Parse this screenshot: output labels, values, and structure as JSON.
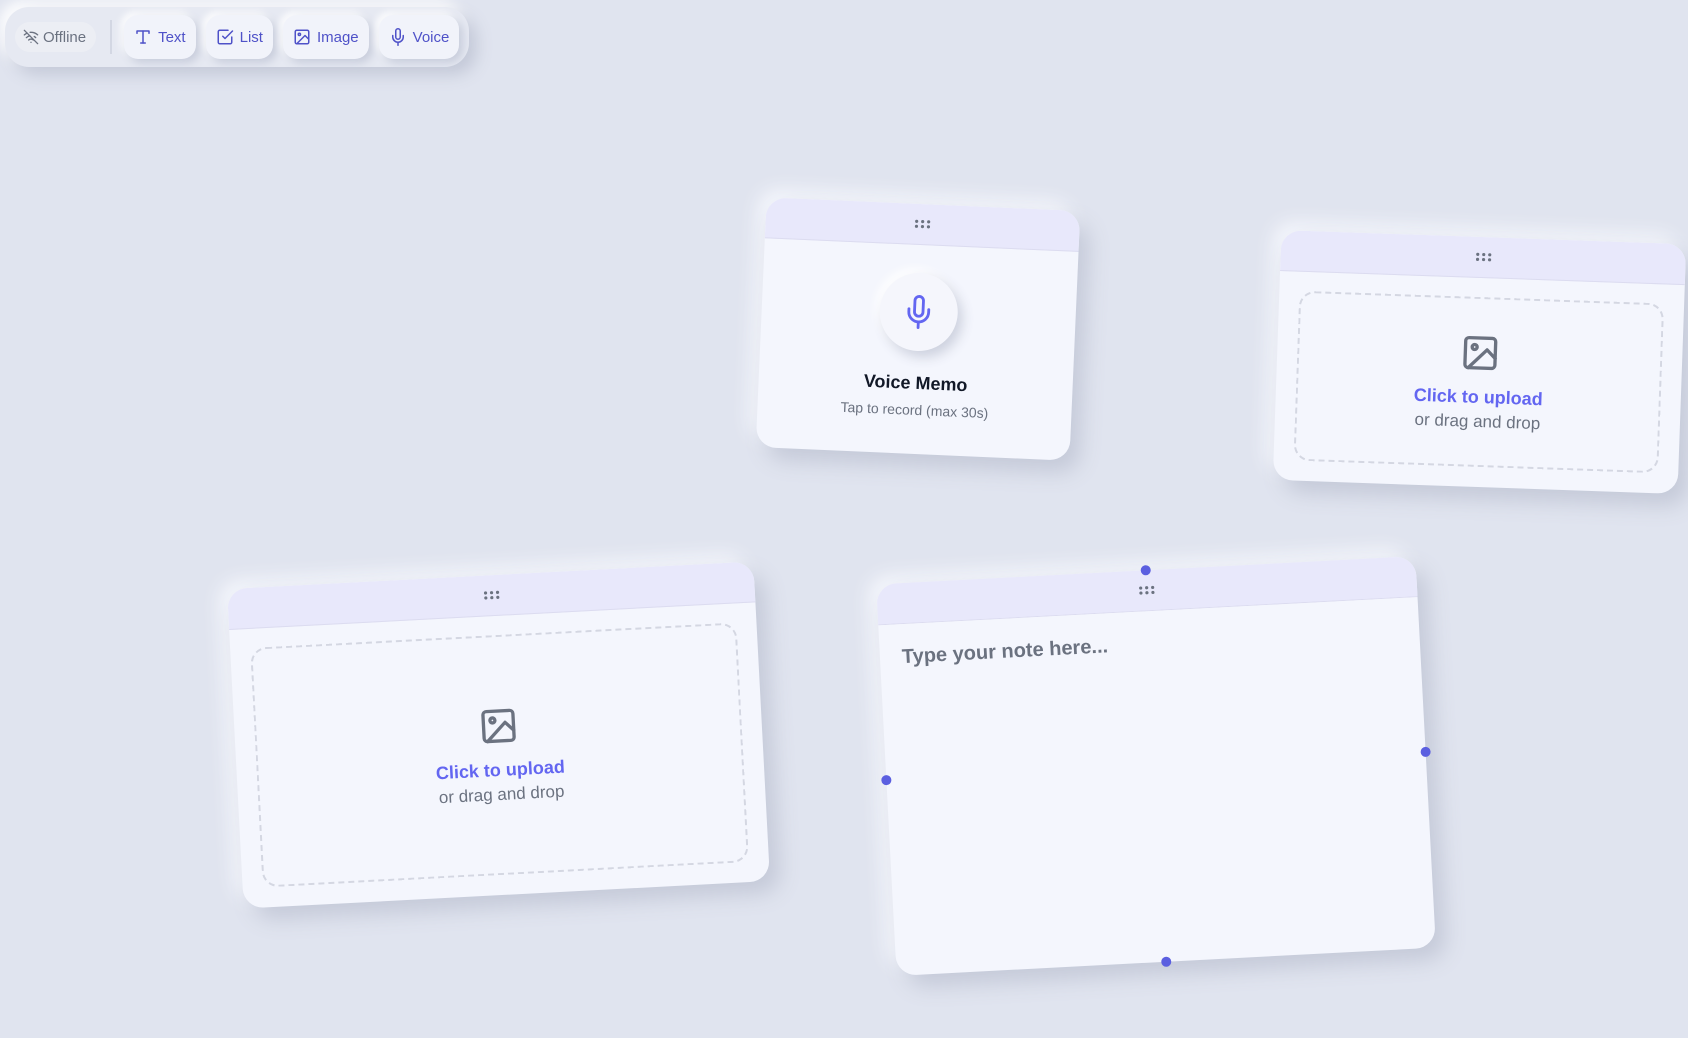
{
  "toolbar": {
    "status_label": "Offline",
    "status_icon": "wifi-off-icon",
    "buttons": [
      {
        "label": "Text",
        "icon": "type-icon"
      },
      {
        "label": "List",
        "icon": "checkbox-icon"
      },
      {
        "label": "Image",
        "icon": "image-icon"
      },
      {
        "label": "Voice",
        "icon": "mic-icon"
      }
    ]
  },
  "voice_card": {
    "title": "Voice Memo",
    "subtitle": "Tap to record (max 30s)",
    "icon": "mic-icon"
  },
  "image_cards": [
    {
      "upload_label": "Click to upload",
      "upload_hint": "or drag and drop",
      "icon": "image-icon"
    },
    {
      "upload_label": "Click to upload",
      "upload_hint": "or drag and drop",
      "icon": "image-icon"
    }
  ],
  "text_card": {
    "placeholder": "Type your note here..."
  },
  "colors": {
    "background": "#e0e4ef",
    "card": "#f4f6fd",
    "card_header": "#e8e8fb",
    "accent": "#6366f1",
    "muted_text": "#6b7280"
  }
}
